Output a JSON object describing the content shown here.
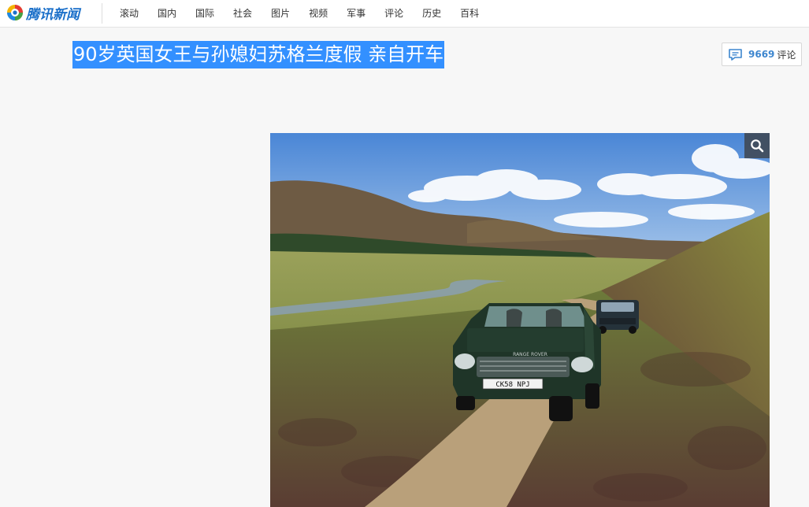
{
  "site": {
    "logo_text": "腾讯新闻",
    "nav": [
      "滚动",
      "国内",
      "国际",
      "社会",
      "图片",
      "视频",
      "军事",
      "评论",
      "历史",
      "百科"
    ]
  },
  "article": {
    "title": "90岁英国女王与孙媳妇苏格兰度假 亲自开车",
    "comment_count": "9669",
    "comment_label": "评论",
    "plate_text": "CK58 NPJ",
    "car_brand_text": "RANGE ROVER"
  },
  "icons": {
    "comment": "comment-icon",
    "zoom": "search-icon"
  },
  "colors": {
    "brand_blue": "#1a6fc9",
    "selection_highlight": "#3390ff",
    "comment_count": "#3d86cf"
  }
}
